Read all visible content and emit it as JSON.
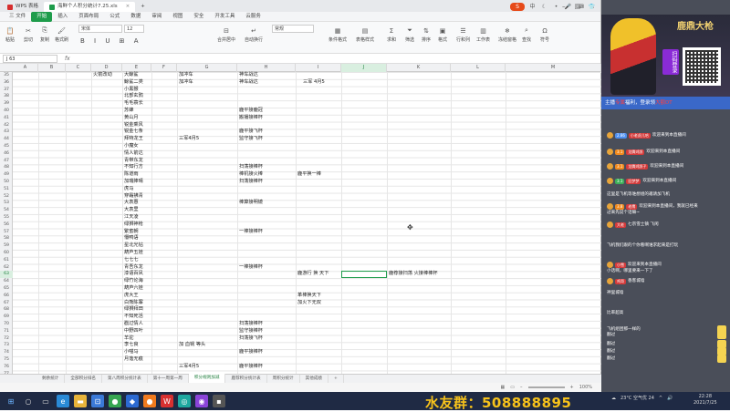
{
  "titlebar": {
    "tabs": [
      {
        "label": "WPS 表格",
        "active": false
      },
      {
        "label": "海鲜个人积分统计7.25.xls",
        "active": true
      }
    ]
  },
  "menubar": {
    "items": [
      "三 文件",
      "开始",
      "插入",
      "页面布局",
      "公式",
      "数据",
      "审阅",
      "视图",
      "安全",
      "开发工具",
      "云服务"
    ],
    "active_index": 1
  },
  "ribbon": {
    "buttons": [
      "粘贴",
      "剪切",
      "复制",
      "格式刷",
      "合并居中",
      "自动换行",
      "条件格式",
      "表格样式",
      "求和",
      "筛选",
      "排序",
      "格式",
      "行和列",
      "工作表",
      "冻结窗格",
      "查找",
      "符号"
    ],
    "font_name": "宋体",
    "font_size": "12",
    "number_format": "常规"
  },
  "formula_bar": {
    "name_box": "J 63",
    "fx": "fx"
  },
  "grid": {
    "columns": [
      "A",
      "B",
      "C",
      "D",
      "E",
      "F",
      "G",
      "H",
      "I",
      "J",
      "K",
      "L",
      "M"
    ],
    "selected_column": "J",
    "row_numbers": [
      35,
      36,
      37,
      38,
      39,
      40,
      41,
      42,
      43,
      44,
      45,
      46,
      47,
      48,
      49,
      50,
      51,
      52,
      53,
      54,
      55,
      56,
      57,
      58,
      59,
      60,
      61,
      62,
      63,
      64,
      65,
      66,
      67,
      68,
      69,
      70,
      71,
      72,
      73,
      74,
      75,
      76,
      77
    ],
    "selected_row": 63,
    "cells": [
      {
        "col": "D",
        "row": 0,
        "text": "火箭改动"
      },
      {
        "col": "E",
        "row": 0,
        "text": "大鲸鲨"
      },
      {
        "col": "E",
        "row": 1,
        "text": "鲸鲨二类"
      },
      {
        "col": "E",
        "row": 2,
        "text": "小黑猴"
      },
      {
        "col": "E",
        "row": 3,
        "text": "北部玄鸦"
      },
      {
        "col": "E",
        "row": 4,
        "text": "毛毛蓑长"
      },
      {
        "col": "E",
        "row": 5,
        "text": "苏蜂"
      },
      {
        "col": "E",
        "row": 6,
        "text": "黄山月"
      },
      {
        "col": "E",
        "row": 7,
        "text": "锐金乘风"
      },
      {
        "col": "E",
        "row": 8,
        "text": "锐金七条"
      },
      {
        "col": "E",
        "row": 9,
        "text": "拜特龙王"
      },
      {
        "col": "E",
        "row": 10,
        "text": "小魔女"
      },
      {
        "col": "E",
        "row": 11,
        "text": "情人箭达"
      },
      {
        "col": "E",
        "row": 12,
        "text": "青带东龙"
      },
      {
        "col": "E",
        "row": 13,
        "text": "不知行方"
      },
      {
        "col": "E",
        "row": 14,
        "text": "陈道雨"
      },
      {
        "col": "E",
        "row": 15,
        "text": "加瑞捧晴"
      },
      {
        "col": "E",
        "row": 16,
        "text": "虎马"
      },
      {
        "col": "E",
        "row": 17,
        "text": "穿霜拂青"
      },
      {
        "col": "E",
        "row": 18,
        "text": "大袁惠"
      },
      {
        "col": "E",
        "row": 19,
        "text": "大袁里"
      },
      {
        "col": "E",
        "row": 20,
        "text": "江天凌"
      },
      {
        "col": "E",
        "row": 21,
        "text": "绿狮神枪"
      },
      {
        "col": "E",
        "row": 22,
        "text": "繁蜜朝"
      },
      {
        "col": "E",
        "row": 23,
        "text": "懵鸭语"
      },
      {
        "col": "E",
        "row": 24,
        "text": "星北光钻"
      },
      {
        "col": "E",
        "row": 25,
        "text": "葫芦五娃"
      },
      {
        "col": "E",
        "row": 26,
        "text": "七七七"
      },
      {
        "col": "E",
        "row": 27,
        "text": "青吾东龙"
      },
      {
        "col": "E",
        "row": 28,
        "text": "漆语百凤"
      },
      {
        "col": "E",
        "row": 29,
        "text": "绿竹论海"
      },
      {
        "col": "E",
        "row": 30,
        "text": "葫芦六娃"
      },
      {
        "col": "E",
        "row": 31,
        "text": "虎大王"
      },
      {
        "col": "E",
        "row": 32,
        "text": "白熊陈寨"
      },
      {
        "col": "E",
        "row": 33,
        "text": "绿狮拜田"
      },
      {
        "col": "E",
        "row": 34,
        "text": "不知死活"
      },
      {
        "col": "E",
        "row": 35,
        "text": "戳过情人"
      },
      {
        "col": "E",
        "row": 36,
        "text": "中野四叶"
      },
      {
        "col": "E",
        "row": 37,
        "text": "羊驼"
      },
      {
        "col": "E",
        "row": 38,
        "text": "李七良"
      },
      {
        "col": "E",
        "row": 39,
        "text": "小喵马"
      },
      {
        "col": "E",
        "row": 40,
        "text": "月落无痕"
      },
      {
        "col": "G",
        "row": 0,
        "text": "加冲车"
      },
      {
        "col": "G",
        "row": 1,
        "text": "加冲车"
      },
      {
        "col": "G",
        "row": 9,
        "text": "三军4月5"
      },
      {
        "col": "G",
        "row": 38,
        "text": "加 血锅  等头"
      },
      {
        "col": "G",
        "row": 41,
        "text": "三军4月5"
      },
      {
        "col": "H",
        "row": 0,
        "text": "神车战达"
      },
      {
        "col": "H",
        "row": 1,
        "text": "神车战达"
      },
      {
        "col": "H",
        "row": 1,
        "text": "三军  4月5",
        "offset": 1
      },
      {
        "col": "H",
        "row": 5,
        "text": "鹿平接鹿冠"
      },
      {
        "col": "H",
        "row": 6,
        "text": "搬播接棒杯"
      },
      {
        "col": "H",
        "row": 8,
        "text": "鹿平接飞杯"
      },
      {
        "col": "H",
        "row": 9,
        "text": "监守接飞杯"
      },
      {
        "col": "H",
        "row": 13,
        "text": "扫荡接棒杯"
      },
      {
        "col": "H",
        "row": 14,
        "text": "棒机接火棒"
      },
      {
        "col": "H",
        "row": 15,
        "text": "扫荡接棒杯"
      },
      {
        "col": "H",
        "row": 18,
        "text": "棒算接明镜"
      },
      {
        "col": "H",
        "row": 22,
        "text": "一棒接棒杯"
      },
      {
        "col": "H",
        "row": 27,
        "text": "一棒接棒杯"
      },
      {
        "col": "H",
        "row": 35,
        "text": "扫荡接棒杯"
      },
      {
        "col": "H",
        "row": 36,
        "text": "监守接棒杯"
      },
      {
        "col": "H",
        "row": 37,
        "text": "扫荡接飞杯"
      },
      {
        "col": "H",
        "row": 39,
        "text": "鹿平接棒杯"
      },
      {
        "col": "H",
        "row": 41,
        "text": "鹿平接棒杯"
      },
      {
        "col": "I",
        "row": 14,
        "text": "鹿平换一棒"
      },
      {
        "col": "I",
        "row": 28,
        "text": "鹿游行  换  天下"
      },
      {
        "col": "I",
        "row": 31,
        "text": "革棒换天下"
      },
      {
        "col": "I",
        "row": 32,
        "text": "加火下无双"
      },
      {
        "col": "K",
        "row": 28,
        "text": "鹿荐接扫荡  火接棒棒杯"
      }
    ]
  },
  "sheet_tabs": {
    "tabs": [
      "剩余统计",
      "全部积分排名",
      "第八周积分统计表",
      "第十一周第一周",
      "积分规则加减",
      "鹿荐积分统计表",
      "周积分统计",
      "其他成绩"
    ],
    "active_index": 4,
    "add_label": "+"
  },
  "status": {
    "zoom": "100%"
  },
  "taskbar": {
    "fan_group_text": "水友群：508888895",
    "weather": "23°C  空气优 24",
    "time": "22:28",
    "date": "2021/7/25"
  },
  "stream": {
    "banner_logo": "鹿鼎大枪",
    "scan_text": "扫码登录",
    "promo_prefix": "主播",
    "promo_red1": "专属",
    "promo_mid": "福利，登录领",
    "promo_red2": "大额DT",
    "chat": [
      {
        "badge": "2.86",
        "user": "小老虎儿哈",
        "text": "欢迎来到本直播间"
      },
      {
        "badge": "3.1",
        "user": "龙腾鸿鹄",
        "text": "欢迎来到本直播间"
      },
      {
        "badge": "3.1",
        "user": "龙腾鸿鹄子",
        "text": "欢迎来到本直播间"
      },
      {
        "badge": "3.1",
        "user": "旧梦梦",
        "text": "欢迎来到本直播间"
      },
      {
        "badge": "",
        "user": "",
        "text": "这里是飞机等谁想组的邀请加飞机"
      },
      {
        "badge": "3.8",
        "user": "老鹰",
        "text": "欢迎来到本直播间，我就已经来"
      },
      {
        "badge": "",
        "user": "",
        "text": "过来先说个话嘛~"
      },
      {
        "badge": "",
        "user": "大老",
        "text": "七宗雪土镇 飞闲"
      },
      {
        "badge": "",
        "user": "",
        "text": "飞机我们跟的个你看啊谁求起来是打玩"
      },
      {
        "badge": "",
        "user": "小雪",
        "text": "欢迎来到本直播间"
      },
      {
        "badge": "",
        "user": "",
        "text": "小话啊，哪里要来一下了"
      },
      {
        "badge": "",
        "user": "鸡哥",
        "text": "香客城墙"
      },
      {
        "badge": "",
        "user": "",
        "text": "神里城墙"
      },
      {
        "badge": "",
        "user": "",
        "text": "比率超高"
      },
      {
        "badge": "",
        "user": "",
        "text": "飞机组团那一样的"
      },
      {
        "badge": "",
        "user": "",
        "text": "翻过"
      },
      {
        "badge": "",
        "user": "",
        "text": "翻过"
      },
      {
        "badge": "",
        "user": "",
        "text": "翻过"
      },
      {
        "badge": "",
        "user": "",
        "text": "翻过"
      }
    ]
  },
  "colors": {
    "accent": "#1e9c4b",
    "panel_bg": "#4a4e59",
    "fan_text": "#f7c21b",
    "promo_bg": "#3a68c8"
  }
}
